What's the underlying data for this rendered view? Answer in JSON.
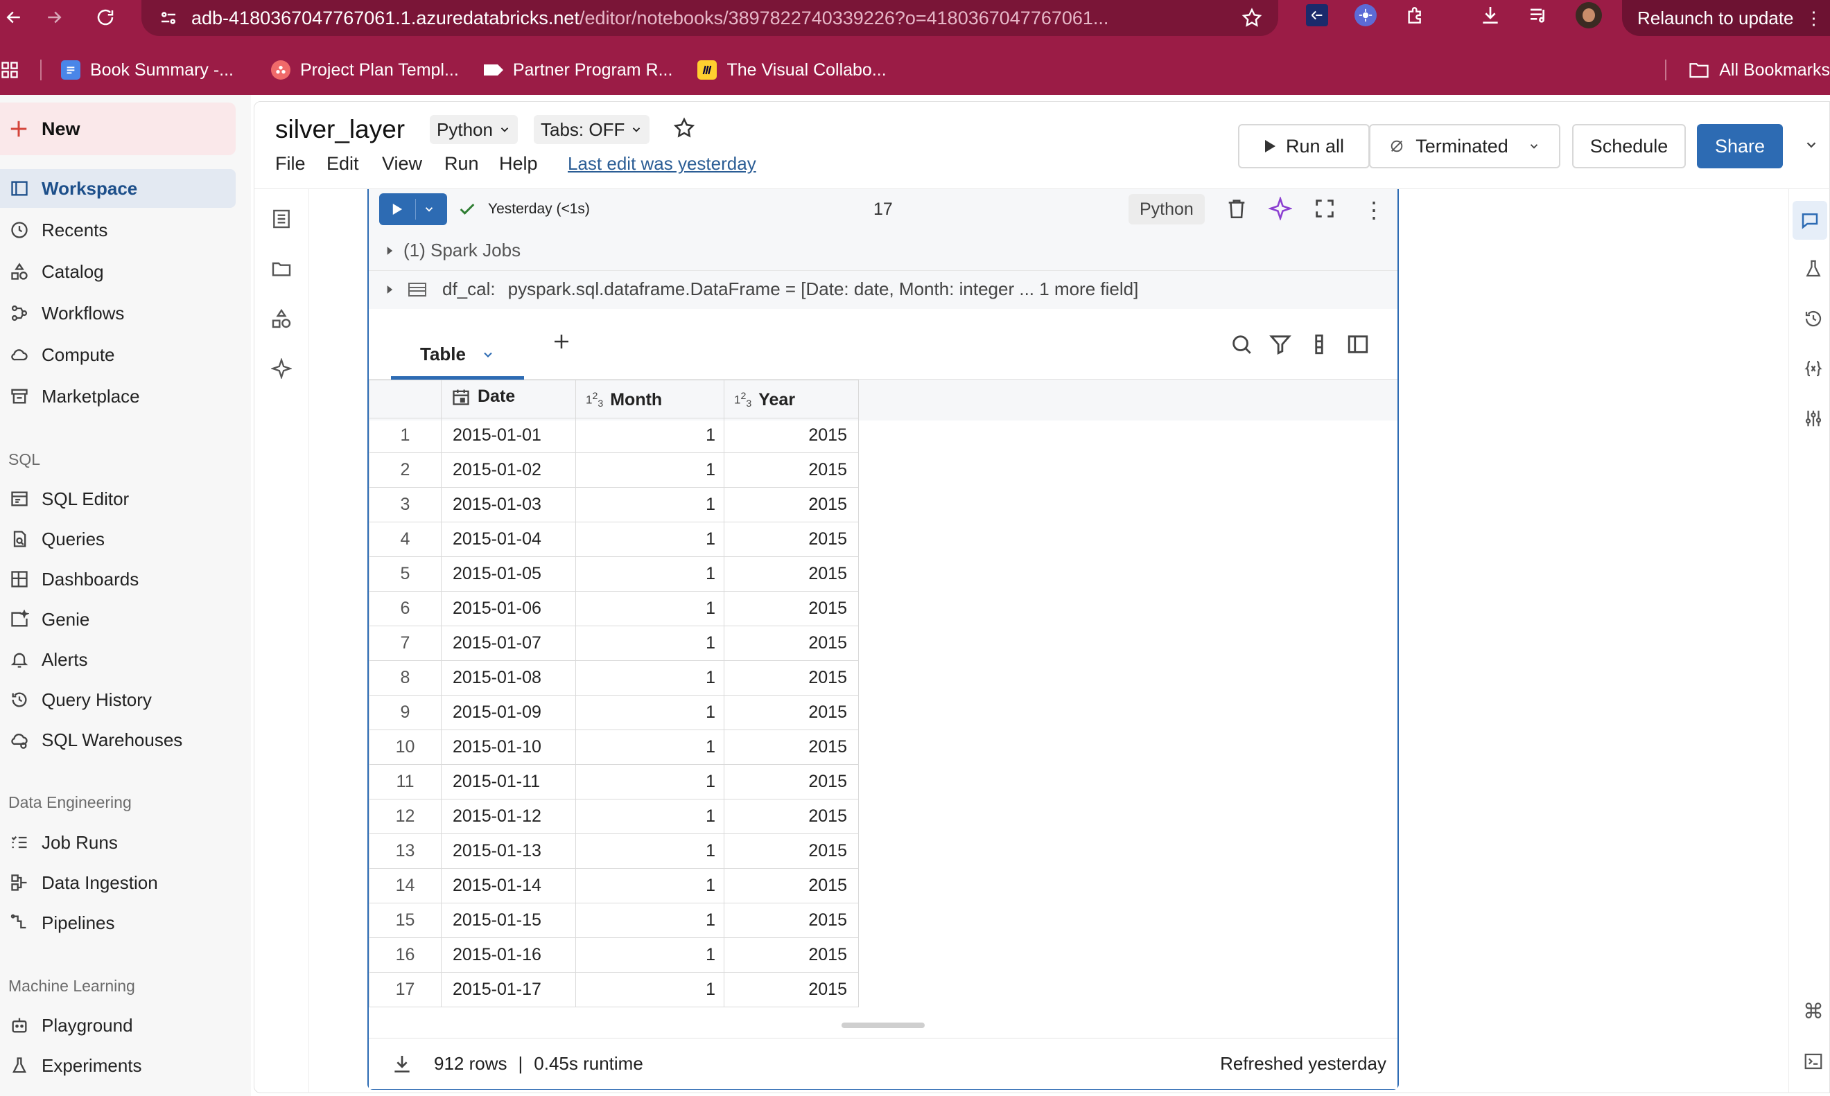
{
  "browser": {
    "url_host": "adb-4180367047767061.1.azuredatabricks.net",
    "url_path": "/editor/notebooks/3897822740339226?o=4180367047767061...",
    "relaunch_label": "Relaunch to update",
    "bookmarks": [
      {
        "label": "Book Summary -...",
        "icon": "doc-icon"
      },
      {
        "label": "Project Plan Templ...",
        "icon": "asana-icon"
      },
      {
        "label": "Partner Program R...",
        "icon": "tag-icon"
      },
      {
        "label": "The Visual Collabo...",
        "icon": "miro-icon"
      }
    ],
    "all_bookmarks_label": "All Bookmarks"
  },
  "sidebar": {
    "new_label": "New",
    "primary": [
      {
        "label": "Workspace",
        "icon": "workspace-icon",
        "active": true
      },
      {
        "label": "Recents",
        "icon": "clock-icon"
      },
      {
        "label": "Catalog",
        "icon": "catalog-icon"
      },
      {
        "label": "Workflows",
        "icon": "workflows-icon"
      },
      {
        "label": "Compute",
        "icon": "cloud-icon"
      },
      {
        "label": "Marketplace",
        "icon": "store-icon"
      }
    ],
    "sql_header": "SQL",
    "sql": [
      {
        "label": "SQL Editor",
        "icon": "sql-editor-icon"
      },
      {
        "label": "Queries",
        "icon": "queries-icon"
      },
      {
        "label": "Dashboards",
        "icon": "dashboards-icon"
      },
      {
        "label": "Genie",
        "icon": "genie-icon"
      },
      {
        "label": "Alerts",
        "icon": "bell-icon"
      },
      {
        "label": "Query History",
        "icon": "history-icon"
      },
      {
        "label": "SQL Warehouses",
        "icon": "warehouse-icon"
      }
    ],
    "de_header": "Data Engineering",
    "de": [
      {
        "label": "Job Runs",
        "icon": "job-runs-icon"
      },
      {
        "label": "Data Ingestion",
        "icon": "ingestion-icon"
      },
      {
        "label": "Pipelines",
        "icon": "pipelines-icon"
      }
    ],
    "ml_header": "Machine Learning",
    "ml": [
      {
        "label": "Playground",
        "icon": "robot-icon"
      },
      {
        "label": "Experiments",
        "icon": "flask-icon"
      }
    ]
  },
  "notebook": {
    "title": "silver_layer",
    "language": "Python",
    "tabs": "Tabs: OFF",
    "menu": [
      "File",
      "Edit",
      "View",
      "Run",
      "Help"
    ],
    "last_edit": "Last edit was yesterday",
    "run_all": "Run all",
    "cluster": "Terminated",
    "schedule": "Schedule",
    "share": "Share"
  },
  "cell": {
    "status": "Yesterday (<1s)",
    "cell_number": "17",
    "language": "Python",
    "spark_jobs": "(1) Spark Jobs",
    "df_name": "df_cal:",
    "df_schema": "pyspark.sql.dataframe.DataFrame = [Date: date, Month: integer ... 1 more field]",
    "result_tab": "Table",
    "columns": [
      "Date",
      "Month",
      "Year"
    ],
    "column_type_icons": [
      "calendar-icon",
      "integer-icon",
      "integer-icon"
    ],
    "rows": [
      [
        "1",
        "2015-01-01",
        "1",
        "2015"
      ],
      [
        "2",
        "2015-01-02",
        "1",
        "2015"
      ],
      [
        "3",
        "2015-01-03",
        "1",
        "2015"
      ],
      [
        "4",
        "2015-01-04",
        "1",
        "2015"
      ],
      [
        "5",
        "2015-01-05",
        "1",
        "2015"
      ],
      [
        "6",
        "2015-01-06",
        "1",
        "2015"
      ],
      [
        "7",
        "2015-01-07",
        "1",
        "2015"
      ],
      [
        "8",
        "2015-01-08",
        "1",
        "2015"
      ],
      [
        "9",
        "2015-01-09",
        "1",
        "2015"
      ],
      [
        "10",
        "2015-01-10",
        "1",
        "2015"
      ],
      [
        "11",
        "2015-01-11",
        "1",
        "2015"
      ],
      [
        "12",
        "2015-01-12",
        "1",
        "2015"
      ],
      [
        "13",
        "2015-01-13",
        "1",
        "2015"
      ],
      [
        "14",
        "2015-01-14",
        "1",
        "2015"
      ],
      [
        "15",
        "2015-01-15",
        "1",
        "2015"
      ],
      [
        "16",
        "2015-01-16",
        "1",
        "2015"
      ],
      [
        "17",
        "2015-01-17",
        "1",
        "2015"
      ]
    ],
    "row_count": "912 rows",
    "separator": "|",
    "runtime": "0.45s runtime",
    "refreshed": "Refreshed yesterday"
  },
  "colors": {
    "browser_chrome": "#9b1c46",
    "accent_blue": "#2d6bb3",
    "new_button_bg": "#fae8ea",
    "success_green": "#2e7d32"
  }
}
